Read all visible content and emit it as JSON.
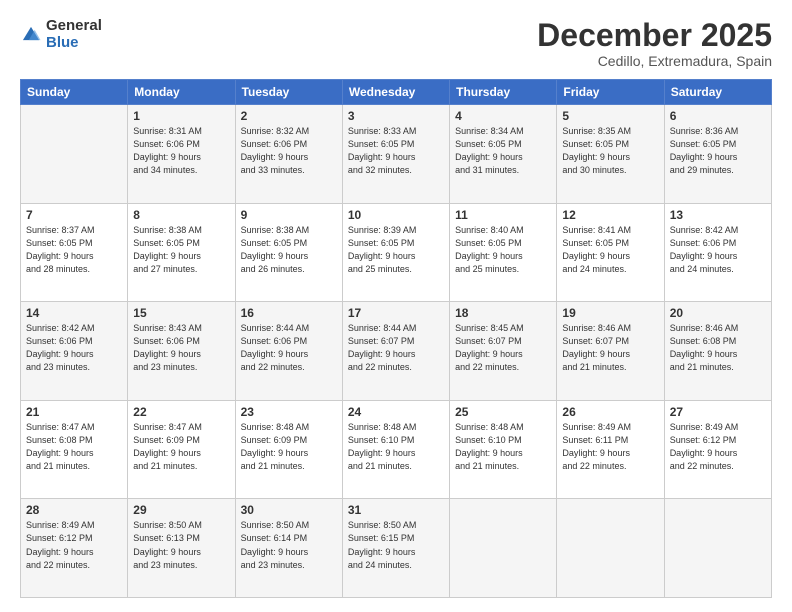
{
  "logo": {
    "general": "General",
    "blue": "Blue"
  },
  "header": {
    "month": "December 2025",
    "location": "Cedillo, Extremadura, Spain"
  },
  "days_of_week": [
    "Sunday",
    "Monday",
    "Tuesday",
    "Wednesday",
    "Thursday",
    "Friday",
    "Saturday"
  ],
  "weeks": [
    [
      {
        "day": "",
        "info": ""
      },
      {
        "day": "1",
        "info": "Sunrise: 8:31 AM\nSunset: 6:06 PM\nDaylight: 9 hours\nand 34 minutes."
      },
      {
        "day": "2",
        "info": "Sunrise: 8:32 AM\nSunset: 6:06 PM\nDaylight: 9 hours\nand 33 minutes."
      },
      {
        "day": "3",
        "info": "Sunrise: 8:33 AM\nSunset: 6:05 PM\nDaylight: 9 hours\nand 32 minutes."
      },
      {
        "day": "4",
        "info": "Sunrise: 8:34 AM\nSunset: 6:05 PM\nDaylight: 9 hours\nand 31 minutes."
      },
      {
        "day": "5",
        "info": "Sunrise: 8:35 AM\nSunset: 6:05 PM\nDaylight: 9 hours\nand 30 minutes."
      },
      {
        "day": "6",
        "info": "Sunrise: 8:36 AM\nSunset: 6:05 PM\nDaylight: 9 hours\nand 29 minutes."
      }
    ],
    [
      {
        "day": "7",
        "info": "Sunrise: 8:37 AM\nSunset: 6:05 PM\nDaylight: 9 hours\nand 28 minutes."
      },
      {
        "day": "8",
        "info": "Sunrise: 8:38 AM\nSunset: 6:05 PM\nDaylight: 9 hours\nand 27 minutes."
      },
      {
        "day": "9",
        "info": "Sunrise: 8:38 AM\nSunset: 6:05 PM\nDaylight: 9 hours\nand 26 minutes."
      },
      {
        "day": "10",
        "info": "Sunrise: 8:39 AM\nSunset: 6:05 PM\nDaylight: 9 hours\nand 25 minutes."
      },
      {
        "day": "11",
        "info": "Sunrise: 8:40 AM\nSunset: 6:05 PM\nDaylight: 9 hours\nand 25 minutes."
      },
      {
        "day": "12",
        "info": "Sunrise: 8:41 AM\nSunset: 6:05 PM\nDaylight: 9 hours\nand 24 minutes."
      },
      {
        "day": "13",
        "info": "Sunrise: 8:42 AM\nSunset: 6:06 PM\nDaylight: 9 hours\nand 24 minutes."
      }
    ],
    [
      {
        "day": "14",
        "info": "Sunrise: 8:42 AM\nSunset: 6:06 PM\nDaylight: 9 hours\nand 23 minutes."
      },
      {
        "day": "15",
        "info": "Sunrise: 8:43 AM\nSunset: 6:06 PM\nDaylight: 9 hours\nand 23 minutes."
      },
      {
        "day": "16",
        "info": "Sunrise: 8:44 AM\nSunset: 6:06 PM\nDaylight: 9 hours\nand 22 minutes."
      },
      {
        "day": "17",
        "info": "Sunrise: 8:44 AM\nSunset: 6:07 PM\nDaylight: 9 hours\nand 22 minutes."
      },
      {
        "day": "18",
        "info": "Sunrise: 8:45 AM\nSunset: 6:07 PM\nDaylight: 9 hours\nand 22 minutes."
      },
      {
        "day": "19",
        "info": "Sunrise: 8:46 AM\nSunset: 6:07 PM\nDaylight: 9 hours\nand 21 minutes."
      },
      {
        "day": "20",
        "info": "Sunrise: 8:46 AM\nSunset: 6:08 PM\nDaylight: 9 hours\nand 21 minutes."
      }
    ],
    [
      {
        "day": "21",
        "info": "Sunrise: 8:47 AM\nSunset: 6:08 PM\nDaylight: 9 hours\nand 21 minutes."
      },
      {
        "day": "22",
        "info": "Sunrise: 8:47 AM\nSunset: 6:09 PM\nDaylight: 9 hours\nand 21 minutes."
      },
      {
        "day": "23",
        "info": "Sunrise: 8:48 AM\nSunset: 6:09 PM\nDaylight: 9 hours\nand 21 minutes."
      },
      {
        "day": "24",
        "info": "Sunrise: 8:48 AM\nSunset: 6:10 PM\nDaylight: 9 hours\nand 21 minutes."
      },
      {
        "day": "25",
        "info": "Sunrise: 8:48 AM\nSunset: 6:10 PM\nDaylight: 9 hours\nand 21 minutes."
      },
      {
        "day": "26",
        "info": "Sunrise: 8:49 AM\nSunset: 6:11 PM\nDaylight: 9 hours\nand 22 minutes."
      },
      {
        "day": "27",
        "info": "Sunrise: 8:49 AM\nSunset: 6:12 PM\nDaylight: 9 hours\nand 22 minutes."
      }
    ],
    [
      {
        "day": "28",
        "info": "Sunrise: 8:49 AM\nSunset: 6:12 PM\nDaylight: 9 hours\nand 22 minutes."
      },
      {
        "day": "29",
        "info": "Sunrise: 8:50 AM\nSunset: 6:13 PM\nDaylight: 9 hours\nand 23 minutes."
      },
      {
        "day": "30",
        "info": "Sunrise: 8:50 AM\nSunset: 6:14 PM\nDaylight: 9 hours\nand 23 minutes."
      },
      {
        "day": "31",
        "info": "Sunrise: 8:50 AM\nSunset: 6:15 PM\nDaylight: 9 hours\nand 24 minutes."
      },
      {
        "day": "",
        "info": ""
      },
      {
        "day": "",
        "info": ""
      },
      {
        "day": "",
        "info": ""
      }
    ]
  ]
}
